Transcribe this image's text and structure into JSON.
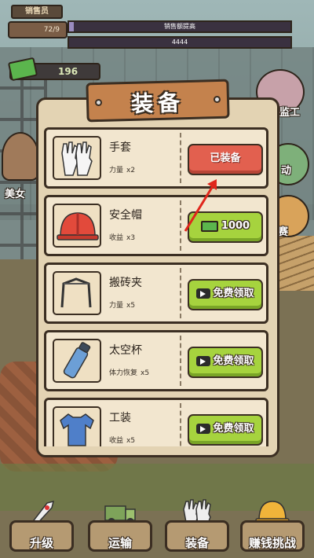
{
  "hud": {
    "level_title": "销售员",
    "progress_text": "72/9",
    "progress_fraction": 0.0,
    "bar_text": "销售额提高",
    "bar_fill_fraction": 0.02,
    "bar2_text": "4444",
    "money": "196"
  },
  "side_buttons": {
    "left_label": "美女",
    "right_top_label": "监工",
    "right_mid_label": "动",
    "right_low_label": "赛"
  },
  "modal": {
    "title": "装备",
    "items": [
      {
        "name": "手套",
        "stat_label": "力量",
        "stat_value": "x2",
        "button": "已装备",
        "button_type": "equipped",
        "icon": "gloves-icon"
      },
      {
        "name": "安全帽",
        "stat_label": "收益",
        "stat_value": "x3",
        "button": "1000",
        "button_type": "price",
        "icon": "helmet-icon"
      },
      {
        "name": "搬砖夹",
        "stat_label": "力量",
        "stat_value": "x5",
        "button": "免费领取",
        "button_type": "free",
        "icon": "brick-clamp-icon"
      },
      {
        "name": "太空杯",
        "stat_label": "体力恢复",
        "stat_value": "x5",
        "button": "免费领取",
        "button_type": "free",
        "icon": "bottle-icon"
      },
      {
        "name": "工装",
        "stat_label": "收益",
        "stat_value": "x5",
        "button": "免费领取",
        "button_type": "free",
        "icon": "uniform-icon"
      }
    ]
  },
  "nav": [
    {
      "label": "升级",
      "icon": "rocket-icon"
    },
    {
      "label": "运输",
      "icon": "truck-icon"
    },
    {
      "label": "装备",
      "icon": "gloves-icon"
    },
    {
      "label": "赚钱挑战",
      "icon": "hardhat-icon"
    }
  ],
  "colors": {
    "equipped_button": "#e2604f",
    "green_button": "#a6d33e",
    "panel": "#e3d3b3",
    "title_board": "#c4824d"
  }
}
